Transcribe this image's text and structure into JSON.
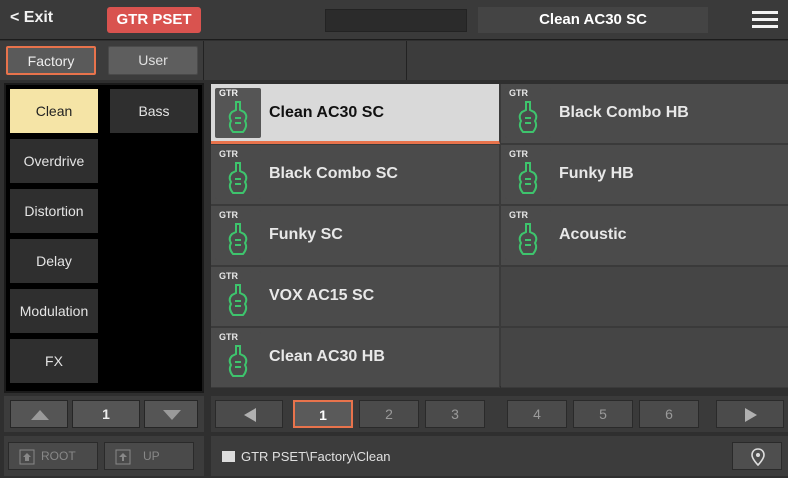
{
  "topbar": {
    "exit_label": "< Exit",
    "mode_badge": "GTR PSET",
    "current_preset": "Clean AC30 SC",
    "menu_icon": "hamburger-menu-icon"
  },
  "source_tabs": [
    {
      "label": "Factory",
      "selected": true
    },
    {
      "label": "User",
      "selected": false
    }
  ],
  "categories": [
    {
      "label": "Clean",
      "selected": true
    },
    {
      "label": "Bass",
      "selected": false
    },
    {
      "label": "Overdrive",
      "selected": false
    },
    {
      "label": "Distortion",
      "selected": false
    },
    {
      "label": "Delay",
      "selected": false
    },
    {
      "label": "Modulation",
      "selected": false
    },
    {
      "label": "FX",
      "selected": false
    }
  ],
  "presets": [
    {
      "tag": "GTR",
      "name": "Clean AC30 SC",
      "selected": true
    },
    {
      "tag": "GTR",
      "name": "Black Combo HB",
      "selected": false
    },
    {
      "tag": "GTR",
      "name": "Black Combo SC",
      "selected": false
    },
    {
      "tag": "GTR",
      "name": "Funky HB",
      "selected": false
    },
    {
      "tag": "GTR",
      "name": "Funky SC",
      "selected": false
    },
    {
      "tag": "GTR",
      "name": "Acoustic",
      "selected": false
    },
    {
      "tag": "GTR",
      "name": "VOX AC15 SC",
      "selected": false
    },
    {
      "tag": "GTR",
      "name": "Clean AC30 HB",
      "selected": false
    }
  ],
  "category_pager": {
    "value": "1"
  },
  "pages": [
    "1",
    "2",
    "3",
    "4",
    "5",
    "6"
  ],
  "current_page": "1",
  "path_nav": {
    "root_label": "ROOT",
    "up_label": "UP"
  },
  "path": "GTR PSET\\Factory\\Clean",
  "colors": {
    "accent": "#e8734c",
    "badge": "#d9534f",
    "selected_category": "#f5e4a6",
    "icon_green": "#3ec46d"
  }
}
